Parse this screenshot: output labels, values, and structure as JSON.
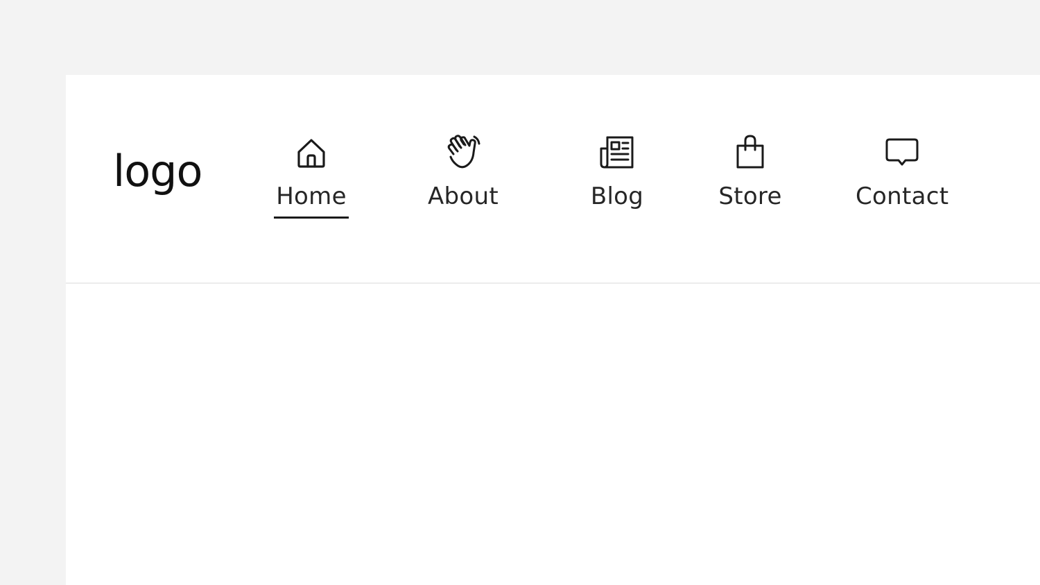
{
  "header": {
    "logo_text": "logo"
  },
  "nav": {
    "items": [
      {
        "label": "Home",
        "icon": "home-icon",
        "active": true
      },
      {
        "label": "About",
        "icon": "waving-hand-icon",
        "active": false
      },
      {
        "label": "Blog",
        "icon": "newspaper-icon",
        "active": false
      },
      {
        "label": "Store",
        "icon": "shopping-bag-icon",
        "active": false
      },
      {
        "label": "Contact",
        "icon": "chat-bubble-icon",
        "active": false
      }
    ]
  },
  "colors": {
    "page_background": "#f3f3f3",
    "card_background": "#ffffff",
    "text": "#1f1f1f",
    "active_underline": "#1a1a1a",
    "divider": "#ececec"
  }
}
